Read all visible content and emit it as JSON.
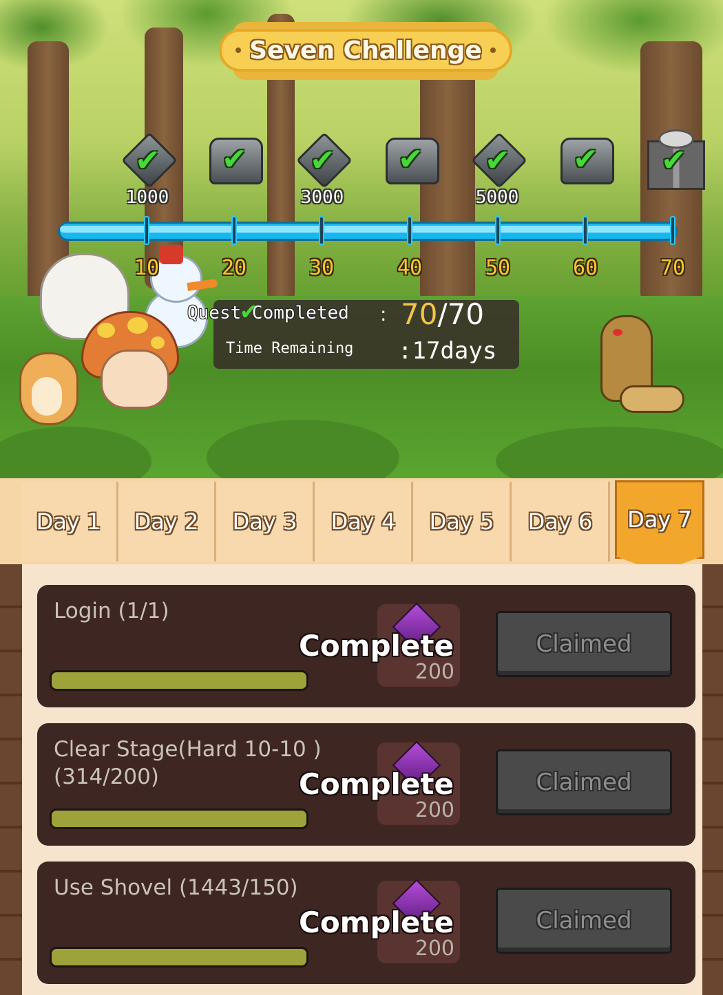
{
  "header": {
    "title": "Seven Challenge"
  },
  "milestones": [
    {
      "label": "1000",
      "reward_icon": "diamond-icon",
      "claimed": true
    },
    {
      "label": "",
      "reward_icon": "chest-icon",
      "claimed": true
    },
    {
      "label": "3000",
      "reward_icon": "diamond-icon",
      "claimed": true
    },
    {
      "label": "",
      "reward_icon": "chest-icon",
      "claimed": true
    },
    {
      "label": "5000",
      "reward_icon": "diamond-icon",
      "claimed": true
    },
    {
      "label": "",
      "reward_icon": "chest-icon",
      "claimed": true
    },
    {
      "label": "",
      "reward_icon": "gift-box-icon",
      "claimed": true
    }
  ],
  "progress": {
    "ticks": [
      "10",
      "20",
      "30",
      "40",
      "50",
      "60",
      "70"
    ],
    "fraction": 1.0
  },
  "status": {
    "quest_label": "Quest Completed",
    "quest_done": "70",
    "quest_total": "/70",
    "time_label": "Time Remaining",
    "time_value": ":17days"
  },
  "tabs": [
    {
      "label": "Day 1",
      "active": false
    },
    {
      "label": "Day 2",
      "active": false
    },
    {
      "label": "Day 3",
      "active": false
    },
    {
      "label": "Day 4",
      "active": false
    },
    {
      "label": "Day 5",
      "active": false
    },
    {
      "label": "Day 6",
      "active": false
    },
    {
      "label": "Day 7",
      "active": true
    }
  ],
  "quests": [
    {
      "name": "Login (1/1)",
      "status": "Complete",
      "reward_amount": "200",
      "button": "Claimed",
      "progress": 1.0
    },
    {
      "name": "Clear Stage(Hard 10-10 ) (314/200)",
      "status": "Complete",
      "reward_amount": "200",
      "button": "Claimed",
      "progress": 1.0
    },
    {
      "name": "Use Shovel (1443/150)",
      "status": "Complete",
      "reward_amount": "200",
      "button": "Claimed",
      "progress": 1.0
    }
  ],
  "colors": {
    "accent_tab": "#f2a72c",
    "progress_bar": "#17b7ee",
    "check": "#47d83a",
    "gold_text": "#f3c54a"
  }
}
